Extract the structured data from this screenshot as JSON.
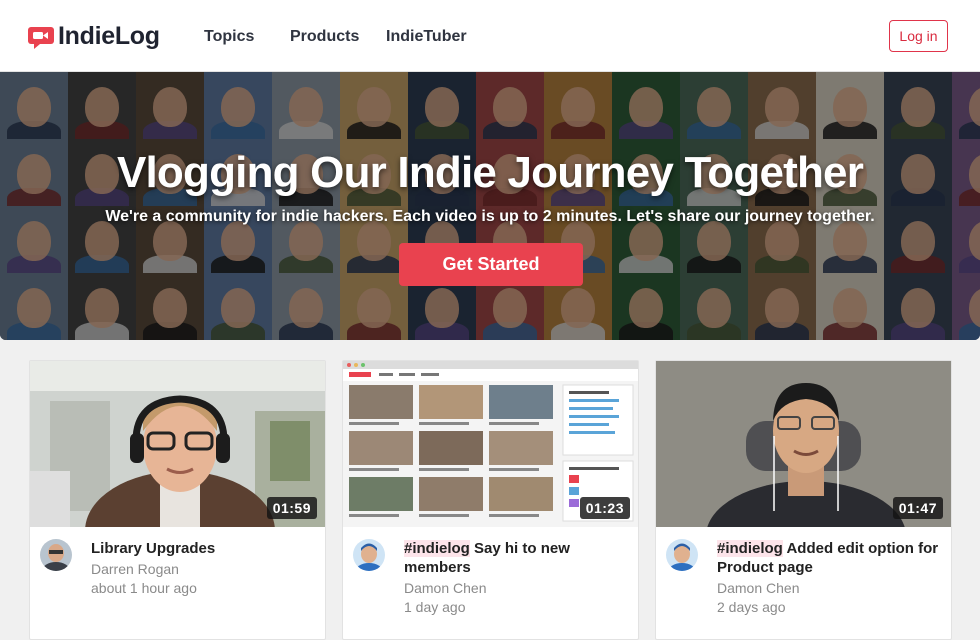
{
  "header": {
    "logo_text": "IndieLog",
    "nav": [
      "Topics",
      "Products",
      "IndieTuber"
    ],
    "login_label": "Log in"
  },
  "hero": {
    "title": "Vlogging Our Indie Journey Together",
    "subtitle": "We're a community for indie hackers. Each video is up to 2 minutes. Let's share our journey together.",
    "cta_label": "Get Started"
  },
  "videos": [
    {
      "tag": "",
      "title": "Library Upgrades",
      "author": "Darren Rogan",
      "time": "about 1 hour ago",
      "duration": "01:59"
    },
    {
      "tag": "#indielog",
      "title": " Say hi to new members",
      "author": "Damon Chen",
      "time": "1 day ago",
      "duration": "01:23"
    },
    {
      "tag": "#indielog",
      "title": " Added edit option for Product page",
      "author": "Damon Chen",
      "time": "2 days ago",
      "duration": "01:47"
    }
  ],
  "colors": {
    "accent": "#e9424f",
    "brand": "#e0344a",
    "tag_bg": "#fde4ea"
  }
}
